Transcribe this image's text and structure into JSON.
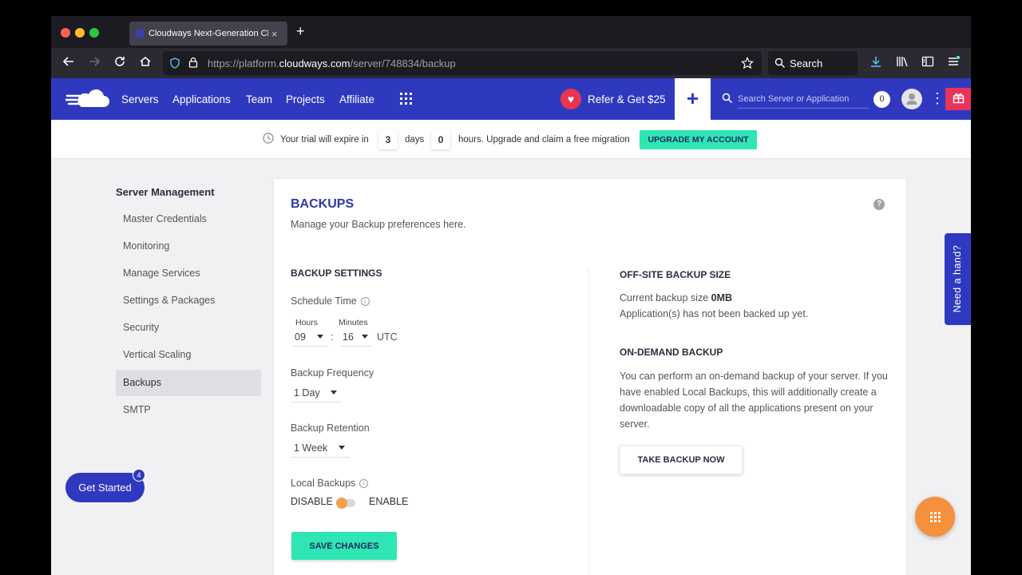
{
  "browser": {
    "tab_title": "Cloudways Next-Generation Clo",
    "tab_close": "×",
    "new_tab": "+",
    "url_prefix": "https://platform.",
    "url_domain": "cloudways.com",
    "url_path": "/server/748834/backup",
    "search_label": "Search"
  },
  "header": {
    "menu": [
      "Servers",
      "Applications",
      "Team",
      "Projects",
      "Affiliate"
    ],
    "refer": "Refer & Get $25",
    "search_placeholder": "Search Server or Application",
    "notifications": "0"
  },
  "trial": {
    "prefix": "Your trial will expire in",
    "days": "3",
    "days_label": "days",
    "hours": "0",
    "suffix": "hours. Upgrade and claim a free migration",
    "button": "UPGRADE MY ACCOUNT"
  },
  "sidebar": {
    "title": "Server Management",
    "items": [
      {
        "label": "Master Credentials"
      },
      {
        "label": "Monitoring"
      },
      {
        "label": "Manage Services"
      },
      {
        "label": "Settings & Packages"
      },
      {
        "label": "Security"
      },
      {
        "label": "Vertical Scaling"
      },
      {
        "label": "Backups",
        "active": true
      },
      {
        "label": "SMTP"
      }
    ]
  },
  "backups": {
    "title": "BACKUPS",
    "subtitle": "Manage your Backup preferences here.",
    "settings_heading": "BACKUP SETTINGS",
    "schedule_label": "Schedule Time",
    "hours_label": "Hours",
    "minutes_label": "Minutes",
    "hours_value": "09",
    "minutes_value": "16",
    "separator": ":",
    "timezone": "UTC",
    "frequency_label": "Backup Frequency",
    "frequency_value": "1 Day",
    "retention_label": "Backup Retention",
    "retention_value": "1 Week",
    "local_label": "Local Backups",
    "disable": "DISABLE",
    "enable": "ENABLE",
    "local_enabled": false,
    "save_button": "SAVE CHANGES",
    "offsite_heading": "OFF-SITE BACKUP SIZE",
    "current_size_label": "Current backup size",
    "current_size_value": "0MB",
    "not_backed_up": "Application(s) has not been backed up yet.",
    "ondemand_heading": "ON-DEMAND BACKUP",
    "ondemand_text": "You can perform an on-demand backup of your server. If you have enabled Local Backups, this will additionally create a downloadable copy of all the applications present on your server.",
    "take_backup_button": "TAKE BACKUP NOW"
  },
  "floating": {
    "get_started": "Get Started",
    "get_started_badge": "4",
    "need_hand": "Need a hand?"
  },
  "colors": {
    "brand": "#2f39bf",
    "accent_green": "#2fe5b4",
    "orange": "#f5903d",
    "gift": "#e8345a"
  }
}
